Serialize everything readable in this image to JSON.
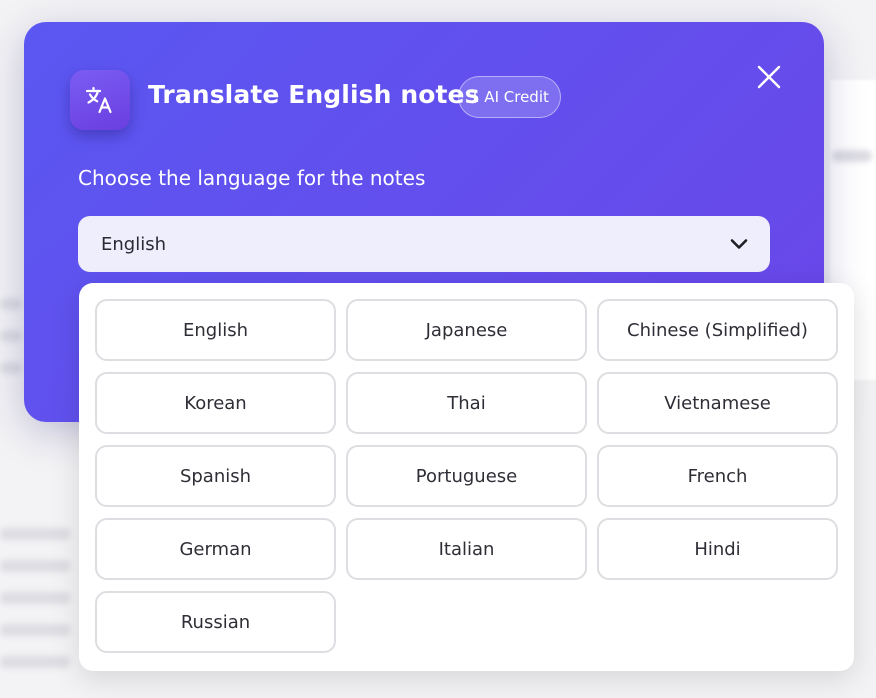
{
  "modal": {
    "title": "Translate English notes",
    "credit_badge": "1 AI Credit",
    "subtitle": "Choose the language for the notes",
    "icons": {
      "app": "translate-icon",
      "close": "close-icon",
      "dropdown": "chevron-down-icon"
    }
  },
  "select": {
    "value": "English"
  },
  "languages": [
    "English",
    "Japanese",
    "Chinese (Simplified)",
    "Korean",
    "Thai",
    "Vietnamese",
    "Spanish",
    "Portuguese",
    "French",
    "German",
    "Italian",
    "Hindi",
    "Russian"
  ],
  "colors": {
    "modal_gradient_start": "#5b57f2",
    "modal_gradient_end": "#6a46e8",
    "select_background": "#efeefd",
    "option_border": "#dedee2"
  }
}
